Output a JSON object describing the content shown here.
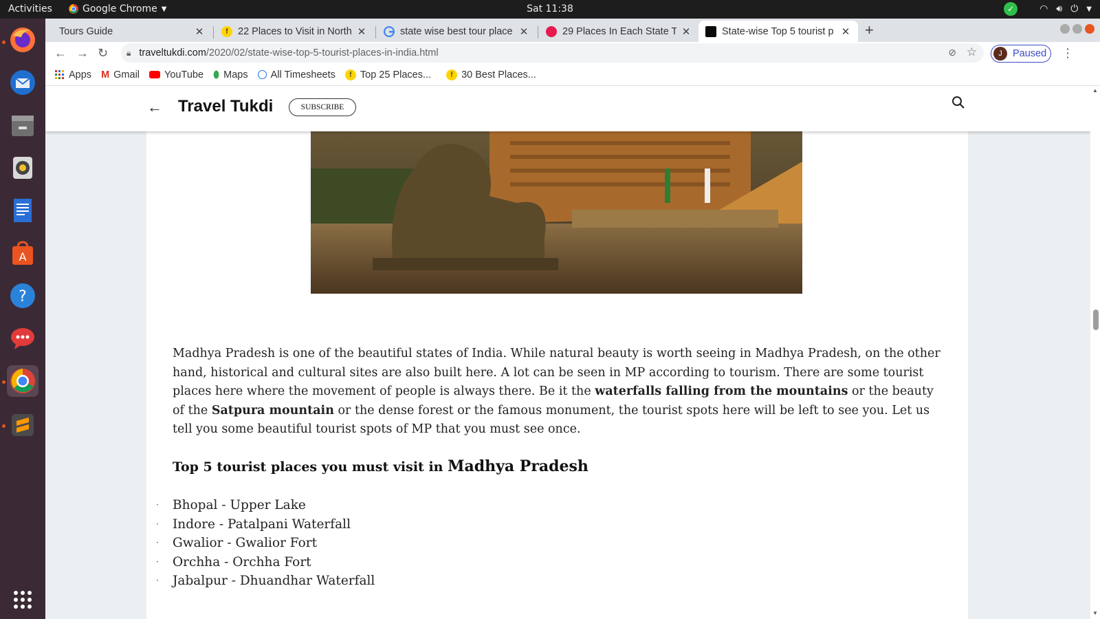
{
  "system": {
    "activities": "Activities",
    "app_name": "Google Chrome",
    "clock": "Sat 11:38"
  },
  "tabs": [
    {
      "title": "Tours Guide",
      "active": false
    },
    {
      "title": "22 Places to Visit in North",
      "active": false
    },
    {
      "title": "state wise best tour place",
      "active": false
    },
    {
      "title": "29 Places In Each State Th",
      "active": false
    },
    {
      "title": "State-wise Top 5 tourist p",
      "active": true
    }
  ],
  "toolbar": {
    "url_host": "traveltukdi.com",
    "url_path": "/2020/02/state-wise-top-5-tourist-places-in-india.html",
    "profile_initial": "J",
    "profile_status": "Paused"
  },
  "bookmarks": [
    {
      "label": "Apps",
      "icon": "apps-grid-icon"
    },
    {
      "label": "Gmail",
      "icon": "gmail-icon"
    },
    {
      "label": "YouTube",
      "icon": "youtube-icon"
    },
    {
      "label": "Maps",
      "icon": "maps-pin-icon"
    },
    {
      "label": "All Timesheets",
      "icon": "timesheets-icon"
    },
    {
      "label": "Top 25 Places...",
      "icon": "site-f-icon"
    },
    {
      "label": "30 Best Places...",
      "icon": "site-f-icon"
    }
  ],
  "site": {
    "title": "Travel Tukdi",
    "subscribe": "SUBSCRIBE"
  },
  "article": {
    "para_1": "Madhya Pradesh is one of the beautiful states of India. While natural beauty is worth seeing in Madhya Pradesh, on the other hand, historical and cultural sites are also built here. A lot can be seen in MP according to tourism. There are some tourist places here where the movement of people is always there. Be it the ",
    "para_bold_1": "waterfalls falling from the mountains",
    "para_2": " or the beauty of the ",
    "para_bold_2": "Satpura mountain",
    "para_3": " or the dense forest or the famous monument, the tourist spots here will be left to see you. Let us tell you some beautiful tourist spots of MP that you must see once.",
    "heading_prefix": "Top 5 tourist places you must visit in ",
    "heading_state": "Madhya Pradesh",
    "places": [
      "Bhopal - Upper Lake",
      "Indore - Patalpani Waterfall",
      "Gwalior - Gwalior Fort",
      "Orchha - Orchha Fort",
      "Jabalpur - Dhuandhar Waterfall"
    ]
  },
  "colors": {
    "dock_bg": "#3b2a35",
    "accent_orange": "#e95420",
    "profile_blue": "#3c4bc4"
  }
}
